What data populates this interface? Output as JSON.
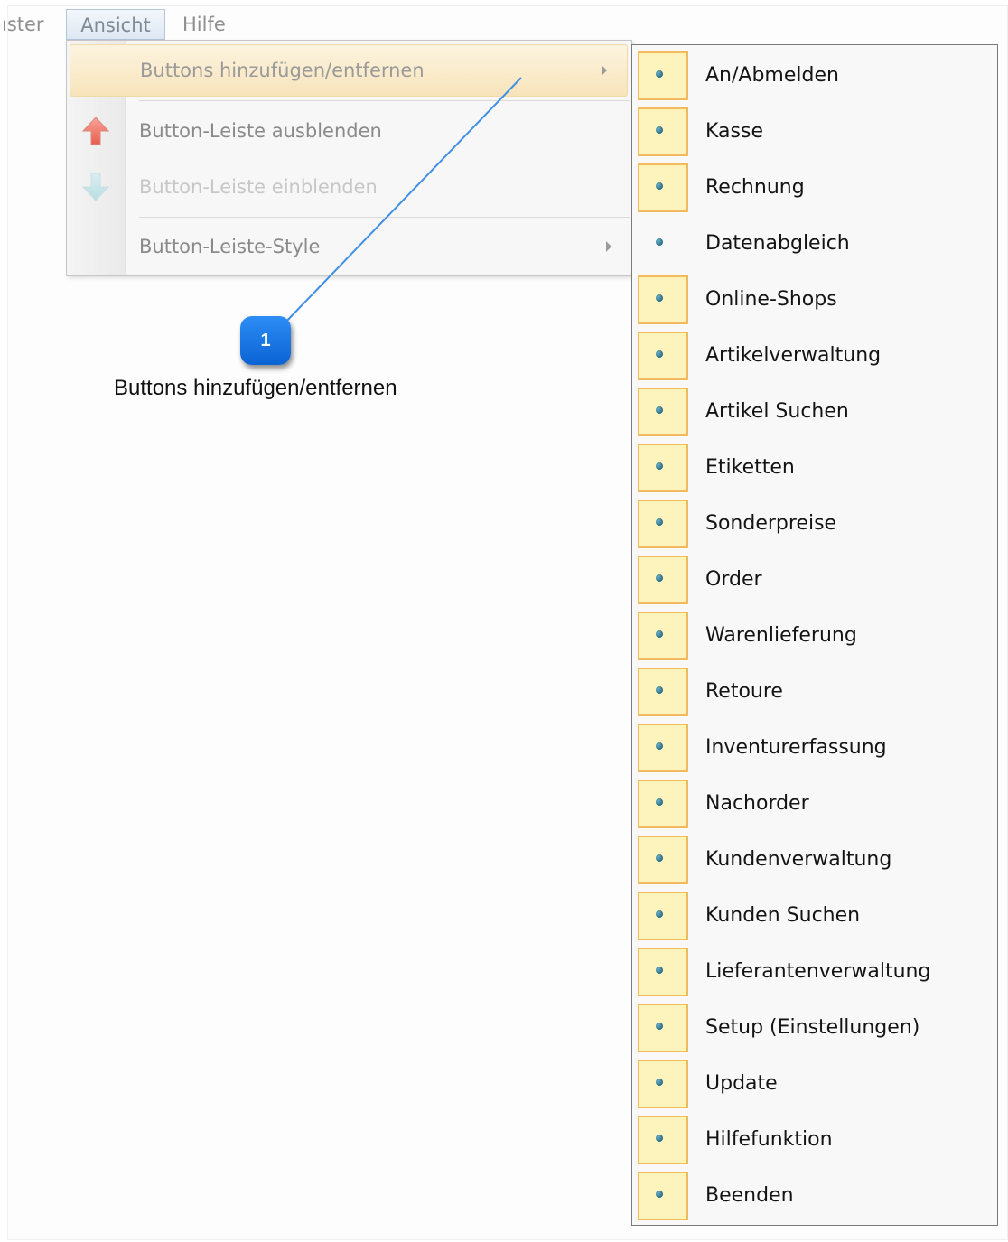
{
  "menubar": {
    "items": [
      {
        "label": "ıster"
      },
      {
        "label": "Ansicht"
      },
      {
        "label": "Hilfe"
      }
    ]
  },
  "dropdown": {
    "items": [
      {
        "label": "Buttons hinzufügen/entfernen",
        "state": "highlighted",
        "has_submenu": true
      },
      {
        "label": "Button-Leiste ausblenden",
        "state": "enabled",
        "icon": "arrow-up-icon"
      },
      {
        "label": "Button-Leiste einblenden",
        "state": "disabled",
        "icon": "arrow-down-icon"
      },
      {
        "label": "Button-Leiste-Style",
        "state": "enabled",
        "has_submenu": true
      }
    ]
  },
  "annotation": {
    "number": "1",
    "caption": "Buttons hinzufügen/entfernen",
    "color": "#1a78e6"
  },
  "submenu": {
    "items": [
      {
        "label": "An/Abmelden",
        "checked": true
      },
      {
        "label": "Kasse",
        "checked": true
      },
      {
        "label": "Rechnung",
        "checked": true
      },
      {
        "label": "Datenabgleich",
        "checked": false
      },
      {
        "label": "Online-Shops",
        "checked": true
      },
      {
        "label": "Artikelverwaltung",
        "checked": true
      },
      {
        "label": "Artikel Suchen",
        "checked": true
      },
      {
        "label": "Etiketten",
        "checked": true
      },
      {
        "label": "Sonderpreise",
        "checked": true
      },
      {
        "label": "Order",
        "checked": true
      },
      {
        "label": "Warenlieferung",
        "checked": true
      },
      {
        "label": "Retoure",
        "checked": true
      },
      {
        "label": "Inventurerfassung",
        "checked": true
      },
      {
        "label": "Nachorder",
        "checked": true
      },
      {
        "label": "Kundenverwaltung",
        "checked": true
      },
      {
        "label": "Kunden Suchen",
        "checked": true
      },
      {
        "label": "Lieferantenverwaltung",
        "checked": true
      },
      {
        "label": "Setup (Einstellungen)",
        "checked": true
      },
      {
        "label": "Update",
        "checked": true
      },
      {
        "label": "Hilfefunktion",
        "checked": true
      },
      {
        "label": "Beenden",
        "checked": true
      }
    ]
  }
}
